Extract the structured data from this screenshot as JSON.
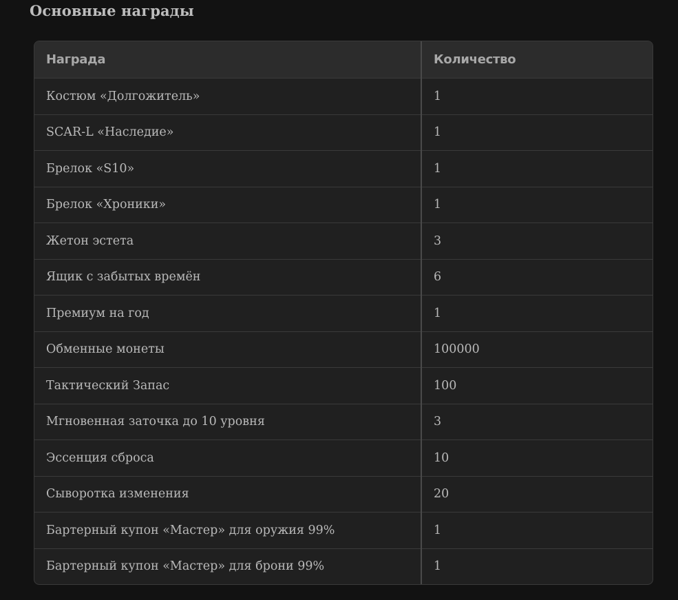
{
  "section": {
    "title": "Основные награды"
  },
  "table": {
    "headers": [
      "Награда",
      "Количество"
    ],
    "rows": [
      {
        "reward": "Костюм «Долгожитель»",
        "quantity": "1"
      },
      {
        "reward": "SCAR-L «Наследие»",
        "quantity": "1"
      },
      {
        "reward": "Брелок «S10»",
        "quantity": "1"
      },
      {
        "reward": "Брелок «Хроники»",
        "quantity": "1"
      },
      {
        "reward": "Жетон эстета",
        "quantity": "3"
      },
      {
        "reward": "Ящик с забытых времён",
        "quantity": "6"
      },
      {
        "reward": "Премиум на год",
        "quantity": "1"
      },
      {
        "reward": "Обменные монеты",
        "quantity": "100000"
      },
      {
        "reward": "Тактический Запас",
        "quantity": "100"
      },
      {
        "reward": "Мгновенная заточка до 10 уровня",
        "quantity": "3"
      },
      {
        "reward": "Эссенция сброса",
        "quantity": "10"
      },
      {
        "reward": "Сыворотка изменения",
        "quantity": "20"
      },
      {
        "reward": "Бартерный купон «Мастер» для оружия 99%",
        "quantity": "1"
      },
      {
        "reward": "Бартерный купон «Мастер» для брони 99%",
        "quantity": "1"
      }
    ]
  },
  "colors": {
    "page_background": "#121212",
    "table_background": "#202020",
    "header_background": "#2c2c2c",
    "text": "#b9b9b9"
  }
}
